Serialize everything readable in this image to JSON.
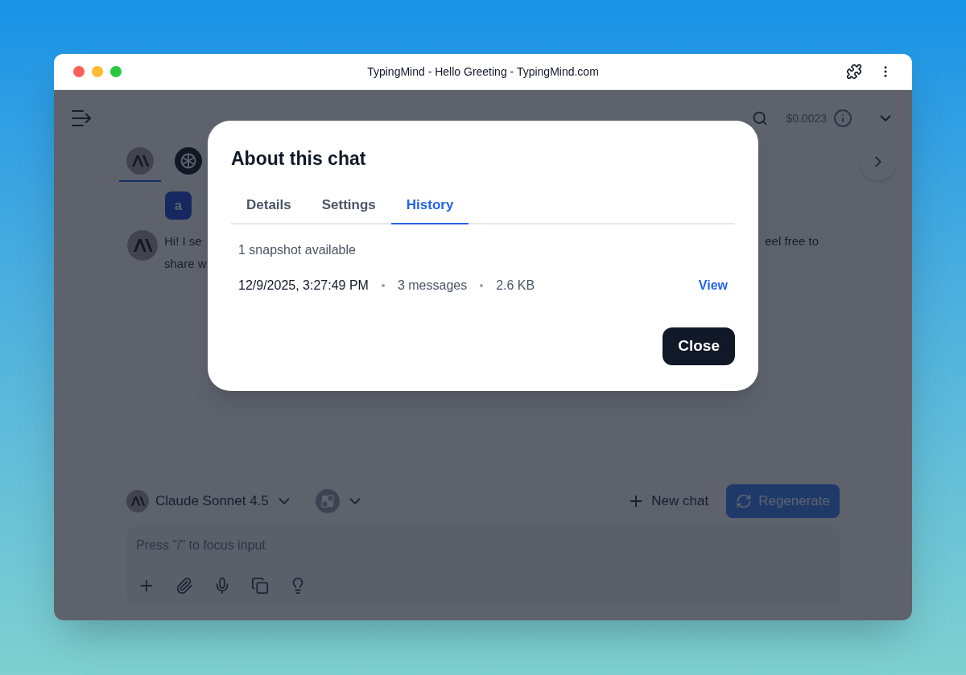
{
  "window": {
    "title": "TypingMind - Hello Greeting - TypingMind.com"
  },
  "header": {
    "cost": "$0.0023"
  },
  "model_tabs": [
    {
      "kind": "anthropic",
      "selected": true
    },
    {
      "kind": "openai",
      "selected": false
    }
  ],
  "user_message": {
    "text": "a"
  },
  "assistant_message": {
    "line_1_start": "Hi! I se",
    "line_1_end": "eel free to",
    "line_2_start": "share w"
  },
  "composer": {
    "model": "Claude Sonnet 4.5",
    "new_chat": "New chat",
    "regenerate": "Regenerate",
    "input": {
      "placeholder": "Press \"/\" to focus input"
    }
  },
  "dialog": {
    "title": "About this chat",
    "tabs": [
      {
        "label": "Details",
        "selected": false
      },
      {
        "label": "Settings",
        "selected": false
      },
      {
        "label": "History",
        "selected": true
      }
    ],
    "summary": "1 snapshot available",
    "snapshots": [
      {
        "time": "12/9/2025, 3:27:49 PM",
        "messages": "3 messages",
        "size": "2.6 KB",
        "action": "View"
      }
    ],
    "close": "Close"
  }
}
